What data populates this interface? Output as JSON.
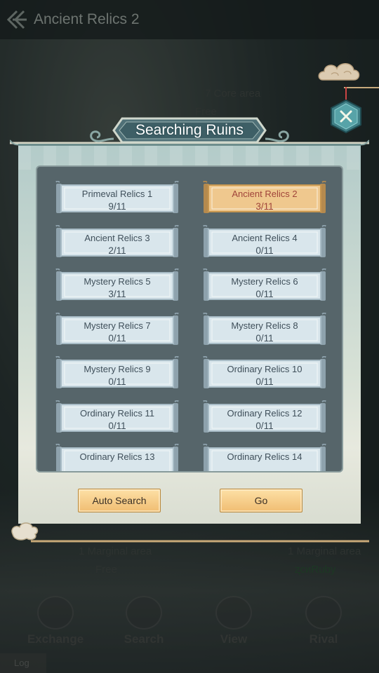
{
  "topbar": {
    "title": "Ancient Relics 2"
  },
  "background": {
    "core_area": "7 Core area",
    "core_cost": "Free",
    "marginal_left": "1 Marginal area",
    "marginal_left_cost": "Free",
    "marginal_right": "1 Marginal area",
    "marginal_right_cost": "ʐсиRuby"
  },
  "nav": {
    "items": [
      {
        "label": "Exchange"
      },
      {
        "label": "Search"
      },
      {
        "label": "View"
      },
      {
        "label": "Rival"
      }
    ]
  },
  "log": {
    "label": "Log"
  },
  "dialog": {
    "title": "Searching Ruins",
    "relics": [
      {
        "name": "Primeval Relics 1",
        "count": "9/11",
        "selected": false
      },
      {
        "name": "Ancient Relics 2",
        "count": "3/11",
        "selected": true
      },
      {
        "name": "Ancient Relics 3",
        "count": "2/11",
        "selected": false
      },
      {
        "name": "Ancient Relics 4",
        "count": "0/11",
        "selected": false
      },
      {
        "name": "Mystery Relics 5",
        "count": "3/11",
        "selected": false
      },
      {
        "name": "Mystery Relics 6",
        "count": "0/11",
        "selected": false
      },
      {
        "name": "Mystery Relics 7",
        "count": "0/11",
        "selected": false
      },
      {
        "name": "Mystery Relics 8",
        "count": "0/11",
        "selected": false
      },
      {
        "name": "Mystery Relics 9",
        "count": "0/11",
        "selected": false
      },
      {
        "name": "Ordinary Relics 10",
        "count": "0/11",
        "selected": false
      },
      {
        "name": "Ordinary Relics 11",
        "count": "0/11",
        "selected": false
      },
      {
        "name": "Ordinary Relics 12",
        "count": "0/11",
        "selected": false
      },
      {
        "name": "Ordinary Relics 13",
        "count": "",
        "selected": false
      },
      {
        "name": "Ordinary Relics 14",
        "count": "",
        "selected": false
      }
    ],
    "auto_search_label": "Auto Search",
    "go_label": "Go"
  },
  "colors": {
    "panel": "#56656a",
    "scroll_normal": "#d9e6ec",
    "scroll_selected": "#efc88e",
    "button": "#f0bd72"
  }
}
